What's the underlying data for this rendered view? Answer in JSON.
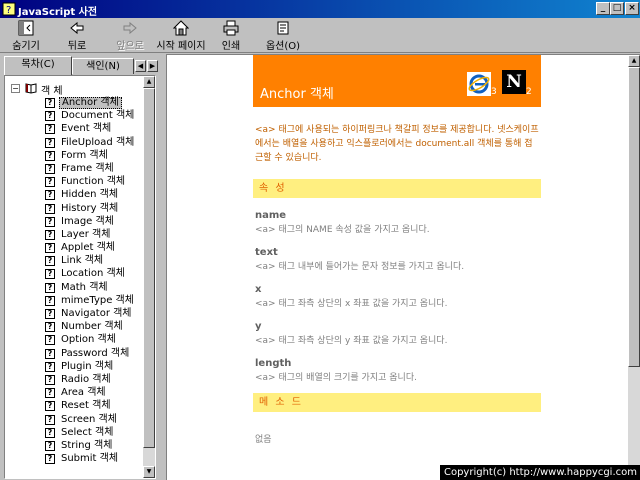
{
  "window": {
    "title": "JavaScript 사전"
  },
  "toolbar": [
    {
      "label": "숨기기",
      "icon": "hide-icon",
      "enabled": true
    },
    {
      "label": "뒤로",
      "icon": "back-arrow-icon",
      "enabled": true
    },
    {
      "label": "앞으로",
      "icon": "forward-arrow-icon",
      "enabled": false
    },
    {
      "label": "시작 페이지",
      "icon": "home-icon",
      "enabled": true
    },
    {
      "label": "인쇄",
      "icon": "printer-icon",
      "enabled": true
    },
    {
      "label": "옵션(O)",
      "icon": "options-icon",
      "enabled": true
    }
  ],
  "tabs": [
    {
      "label": "목차(C)",
      "active": true
    },
    {
      "label": "색인(N)",
      "active": false
    }
  ],
  "tree": {
    "root": "객 체",
    "items": [
      "Anchor 객체",
      "Document 객체",
      "Event 객체",
      "FileUpload 객체",
      "Form 객체",
      "Frame 객체",
      "Function 객체",
      "Hidden 객체",
      "History 객체",
      "Image 객체",
      "Layer 객체",
      "Applet 객체",
      "Link 객체",
      "Location 객체",
      "Math 객체",
      "mimeType 객체",
      "Navigator 객체",
      "Number 객체",
      "Option 객체",
      "Password 객체",
      "Plugin 객체",
      "Radio 객체",
      "Area 객체",
      "Reset 객체",
      "Screen 객체",
      "Select 객체",
      "String 객체",
      "Submit 객체"
    ],
    "selected_index": 0
  },
  "content": {
    "title": "Anchor 객체",
    "ie_version": "3",
    "ns_logo_letter": "N",
    "ns_version": "2",
    "description": "<a> 태그에 사용되는 하이퍼링크나 책갈피 정보를 제공합니다. 넷스케이프에서는 배열을 사용하고 익스플로러에서는 document.all 객체를 통해 접근할 수 있습니다.",
    "properties_heading": "속    성",
    "properties": [
      {
        "name": "name",
        "desc": "<a> 태그의 NAME 속성 값을 가지고 옵니다."
      },
      {
        "name": "text",
        "desc": "<a> 태그 내부에 들어가는 문자 정보를 가지고 옵니다."
      },
      {
        "name": "x",
        "desc": "<a> 태그 좌측 상단의 x 좌표 값을 가지고 옵니다."
      },
      {
        "name": "y",
        "desc": "<a> 태그 좌측 상단의 y 좌표 값을 가지고 옵니다."
      },
      {
        "name": "length",
        "desc": "<a> 태그의 배열의 크기를 가지고 옵니다."
      }
    ],
    "methods_heading": "메 소 드",
    "methods_none": "없음"
  },
  "footer": {
    "copyright": "Copyright(c) http://www.happycgi.com"
  },
  "colors": {
    "header_orange": "#ff8000",
    "section_yellow": "#ffef80",
    "title_blue": "#000080"
  }
}
